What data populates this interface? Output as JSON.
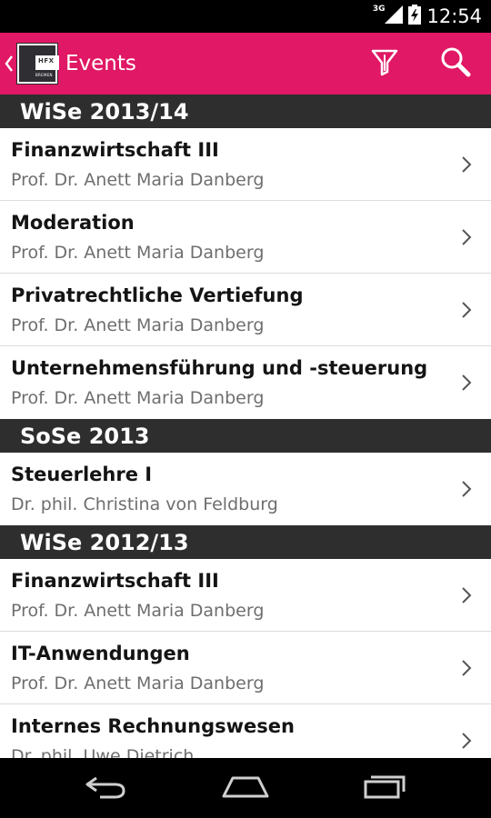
{
  "status_bar": {
    "network": "3G",
    "time": "12:54"
  },
  "action_bar": {
    "logo_text": "HFX",
    "logo_subtext": "BREMEN",
    "title": "Events",
    "icons": [
      "back-caret-icon",
      "filter-icon",
      "search-icon"
    ],
    "background_color": "#e01865"
  },
  "sections": [
    {
      "header": "WiSe 2013/14",
      "items": [
        {
          "title": "Finanzwirtschaft III",
          "subtitle": "Prof. Dr. Anett Maria Danberg"
        },
        {
          "title": "Moderation",
          "subtitle": "Prof. Dr. Anett Maria Danberg"
        },
        {
          "title": "Privatrechtliche Vertiefung",
          "subtitle": "Prof. Dr. Anett Maria Danberg"
        },
        {
          "title": "Unternehmensführung und -steuerung",
          "subtitle": "Prof. Dr. Anett Maria Danberg"
        }
      ]
    },
    {
      "header": "SoSe 2013",
      "items": [
        {
          "title": "Steuerlehre I",
          "subtitle": "Dr. phil. Christina von Feldburg"
        }
      ]
    },
    {
      "header": "WiSe 2012/13",
      "items": [
        {
          "title": "Finanzwirtschaft III",
          "subtitle": "Prof. Dr. Anett Maria Danberg"
        },
        {
          "title": "IT-Anwendungen",
          "subtitle": "Prof. Dr. Anett Maria Danberg"
        },
        {
          "title": "Internes Rechnungswesen",
          "subtitle": "Dr. phil. Uwe Dietrich"
        }
      ]
    }
  ],
  "nav_bar": {
    "icons": [
      "back-icon",
      "home-icon",
      "recent-apps-icon"
    ]
  }
}
